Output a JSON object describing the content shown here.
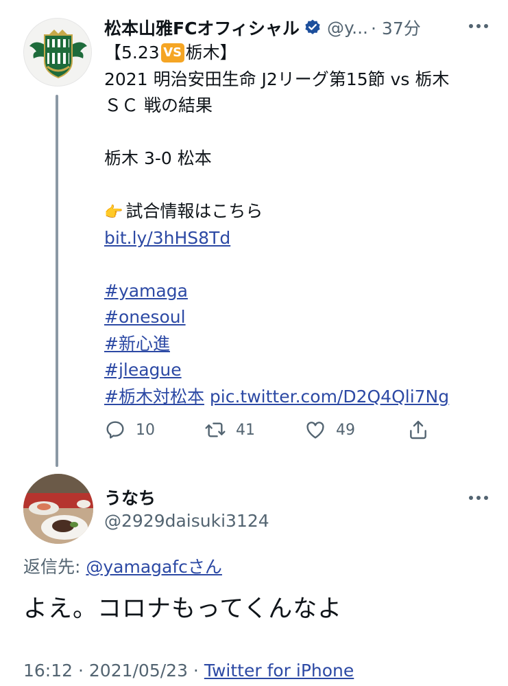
{
  "original_tweet": {
    "display_name": "松本山雅FCオフィシャル",
    "handle": "@y...",
    "time": "· 37分",
    "body": {
      "line1_before": "【5.23",
      "vs_badge": "VS",
      "line1_after": "栃木】",
      "line2": "2021 明治安田生命 J2リーグ第15節 vs 栃木",
      "line3": "ＳＣ 戦の結果",
      "score": "栃木 3-0 松本",
      "info_text": "試合情報はこちら",
      "link": "bit.ly/3hHS8Td",
      "hashtags": [
        "#yamaga",
        "#onesoul",
        "#新心進",
        "#jleague"
      ],
      "last_hashtag": "#栃木対松本",
      "pic_link": "pic.twitter.com/D2Q4Qli7Ng"
    },
    "stats": {
      "replies": "10",
      "retweets": "41",
      "likes": "49"
    }
  },
  "reply_tweet": {
    "display_name": "うなち",
    "handle": "@2929daisuki3124",
    "reply_to_label": "返信先:",
    "reply_to_user": "@yamagafcさん",
    "text": "よえ。コロナもってくんなよ",
    "time": "16:12 · 2021/05/23 ·",
    "source": "Twitter for iPhone"
  },
  "colors": {
    "link": "#2c49a4",
    "secondary_text": "#536471",
    "verified": "#1d4f9c",
    "vs_badge": "#f5a524",
    "thread_line": "#8b98a5"
  },
  "icons": {
    "verified": "verified-badge-icon",
    "more": "more-options-icon",
    "reply": "reply-icon",
    "retweet": "retweet-icon",
    "like": "heart-icon",
    "share": "share-icon",
    "pointing_hand": "pointing-hand-emoji"
  }
}
